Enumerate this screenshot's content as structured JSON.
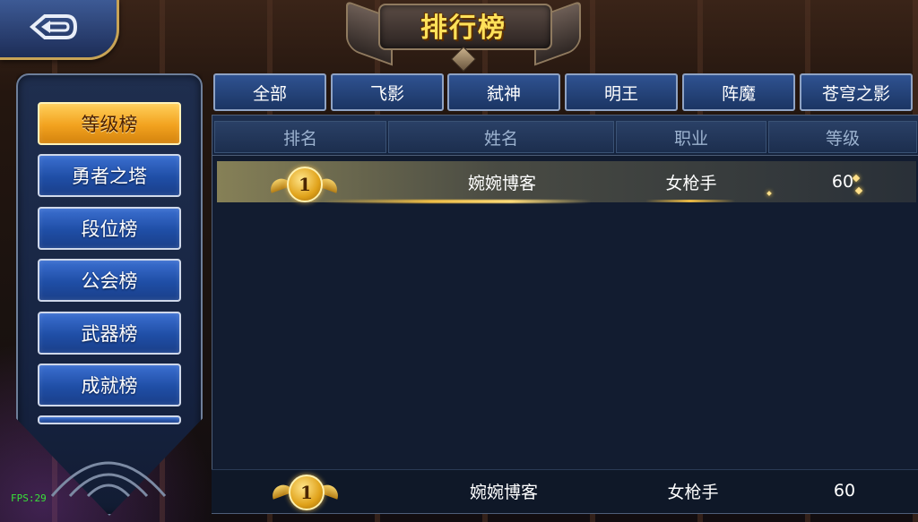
{
  "header": {
    "title": "排行榜",
    "back_icon": "back-arrow-icon"
  },
  "sidebar": {
    "items": [
      {
        "label": "等级榜",
        "active": true
      },
      {
        "label": "勇者之塔",
        "active": false
      },
      {
        "label": "段位榜",
        "active": false
      },
      {
        "label": "公会榜",
        "active": false
      },
      {
        "label": "武器榜",
        "active": false
      },
      {
        "label": "成就榜",
        "active": false
      }
    ]
  },
  "tabs": [
    "全部",
    "飞影",
    "弑神",
    "明王",
    "阵魔",
    "苍穹之影"
  ],
  "table": {
    "columns": [
      "排名",
      "姓名",
      "职业",
      "等级"
    ],
    "rows": [
      {
        "rank": "1",
        "name": "婉婉博客",
        "job": "女枪手",
        "level": "60"
      }
    ]
  },
  "self_row": {
    "rank": "1",
    "name": "婉婉博客",
    "job": "女枪手",
    "level": "60"
  },
  "debug": {
    "fps": "FPS:29"
  },
  "colors": {
    "active_tab": "#f2a21e",
    "button_blue": "#1f4ea6",
    "title_gold": "#ffe15a",
    "fps_green": "#39e239"
  }
}
